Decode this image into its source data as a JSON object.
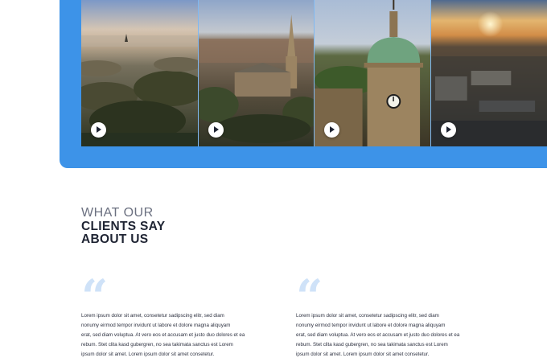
{
  "colors": {
    "accent": "#3d93e8",
    "quote_mark": "#cfe2f8",
    "heading_light": "#6b7080",
    "heading_dark": "#1f2433"
  },
  "gallery": {
    "tiles": [
      {
        "name": "misty-town-sunrise",
        "play_icon": "play-icon"
      },
      {
        "name": "church-spire-aerial",
        "play_icon": "play-icon"
      },
      {
        "name": "clock-tower-green-dome",
        "play_icon": "play-icon"
      },
      {
        "name": "sunset-rooftops",
        "play_icon": "play-icon"
      }
    ]
  },
  "testimonials_section": {
    "heading_light": "WHAT OUR",
    "heading_bold_line1": "CLIENTS SAY",
    "heading_bold_line2": "ABOUT US",
    "quote_glyph": "“",
    "items": [
      {
        "text": "Lorem ipsum dolor sit amet, consetetur sadipscing elitr, sed diam\nnonumy eirmod tempor invidunt ut labore et dolore magna aliquyam\nerat, sed diam voluptua. At vero eos et accusam et justo duo dolores et ea\nrebum. Stet clita kasd gubergren, no sea takimata sanctus est Lorem\nipsum dolor sit amet. Lorem ipsum dolor sit amet consetetur."
      },
      {
        "text": "Lorem ipsum dolor sit amet, consetetur sadipscing elitr, sed diam\nnonumy eirmod tempor invidunt ut labore et dolore magna aliquyam\nerat, sed diam voluptua. At vero eos et accusam et justo duo dolores et ea\nrebum. Stet clita kasd gubergren, no sea takimata sanctus est Lorem\nipsum dolor sit amet. Lorem ipsum dolor sit amet consetetur."
      }
    ]
  }
}
